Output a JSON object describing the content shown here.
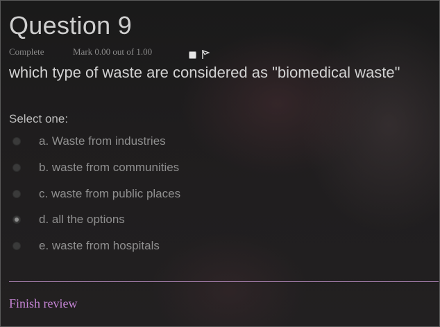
{
  "question": {
    "title": "Question 9",
    "status": "Complete",
    "mark": "Mark 0.00 out of 1.00",
    "text": "which type of waste are considered as \"biomedical waste\"",
    "prompt": "Select one:",
    "flag_icon": "flag-icon",
    "options": [
      {
        "label": "a. Waste from industries",
        "selected": false
      },
      {
        "label": "b. waste from communities",
        "selected": false
      },
      {
        "label": "c. waste from public places",
        "selected": false
      },
      {
        "label": "d. all the options",
        "selected": true
      },
      {
        "label": "e. waste from hospitals",
        "selected": false
      }
    ]
  },
  "footer": {
    "finish_review": "Finish review"
  },
  "colors": {
    "link": "#c685d6",
    "divider": "#a07aa6"
  }
}
